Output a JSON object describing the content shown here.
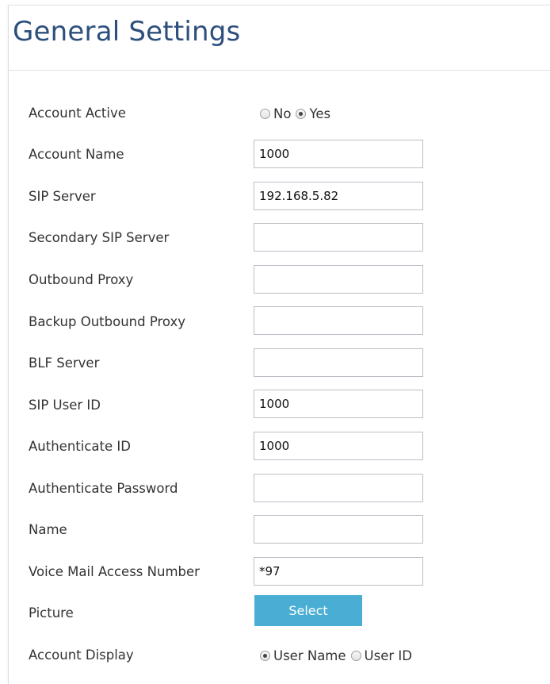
{
  "page": {
    "title": "General Settings"
  },
  "fields": {
    "account_active": {
      "label": "Account Active",
      "options": [
        "No",
        "Yes"
      ],
      "selected": "Yes"
    },
    "account_name": {
      "label": "Account Name",
      "value": "1000"
    },
    "sip_server": {
      "label": "SIP Server",
      "value": "192.168.5.82"
    },
    "secondary_sip_server": {
      "label": "Secondary SIP Server",
      "value": ""
    },
    "outbound_proxy": {
      "label": "Outbound Proxy",
      "value": ""
    },
    "backup_outbound_proxy": {
      "label": "Backup Outbound Proxy",
      "value": ""
    },
    "blf_server": {
      "label": "BLF Server",
      "value": ""
    },
    "sip_user_id": {
      "label": "SIP User ID",
      "value": "1000"
    },
    "authenticate_id": {
      "label": "Authenticate ID",
      "value": "1000"
    },
    "authenticate_password": {
      "label": "Authenticate Password",
      "value": ""
    },
    "name": {
      "label": "Name",
      "value": ""
    },
    "voice_mail_access_number": {
      "label": "Voice Mail Access Number",
      "value": "*97"
    },
    "picture": {
      "label": "Picture",
      "button_label": "Select"
    },
    "account_display": {
      "label": "Account Display",
      "options": [
        "User Name",
        "User ID"
      ],
      "selected": "User Name"
    }
  },
  "colors": {
    "title": "#2d4f7e",
    "button": "#4aaed4",
    "field_border": "#b9bec5"
  }
}
